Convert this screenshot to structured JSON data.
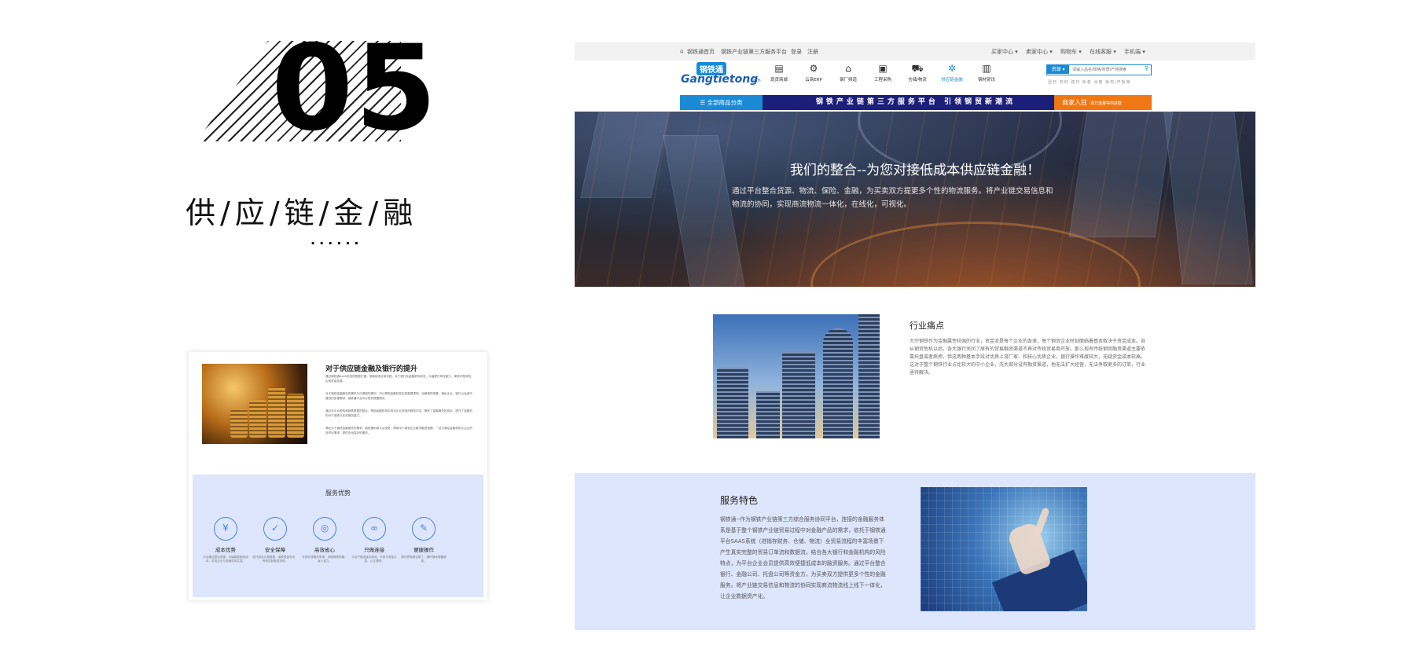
{
  "section": {
    "number": "05",
    "title": "供/应/链/金/融",
    "dots": "······"
  },
  "card": {
    "title": "对于供应链金融及银行的提升",
    "paragraphs": [
      "通过钢铁通SaaS系统的数据打通，准确反映交易流程，对于银行及金融机构而言，大幅提升风控能力，降低坏账风险，实现双赢发展。",
      "对于钢铁金融服务的需求与日俱增的情况，可以帮助金融机构实现数据透明，化解借贷难题，满足企业、银行以及城市建设的多重需求，钢铁通平台可以提供便捷服务。",
      "通过对平台采购和销售数据的整合，帮助金融机构实现对企业资信的精准评估，降低了金融服务的成本，提升了金融机构对于钢铁行业的服务能力。",
      "满足对于钢铁金融服务的需求，钢铁通利用平台优势，帮助中小钢铁企业解决融资难题，一站式满足金融机构与企业的多样化需求，提供安全高效的服务。"
    ],
    "services_title": "服务优势",
    "services": [
      {
        "icon": "cost-icon",
        "glyph": "¥",
        "name": "成本优势",
        "desc": "平台通过整合资源，大幅降低融资成本，实现企业与金融机构共赢。"
      },
      {
        "icon": "shield-icon",
        "glyph": "✓",
        "name": "安全保障",
        "desc": "依托真实交易数据，保障资金安全，有效控制各类风险。"
      },
      {
        "icon": "target-icon",
        "glyph": "◎",
        "name": "高效省心",
        "desc": "在线完成融资申请，流程简便快捷，省心省力。"
      },
      {
        "icon": "link-icon",
        "glyph": "∞",
        "name": "只做连接",
        "desc": "平台只做连接与服务，不参与资金交易，公正透明。"
      },
      {
        "icon": "doc-icon",
        "glyph": "✎",
        "name": "便捷操作",
        "desc": "操作界面简洁明了，随时随地便捷使用。"
      }
    ]
  },
  "site": {
    "topbar_left": [
      "钢铁通首页",
      "钢铁产业链第三方服务平台",
      "登录",
      "注册"
    ],
    "topbar_right": [
      "买家中心 ▾",
      "卖家中心 ▾",
      "购物车 ▾",
      "在线客服 ▾",
      "手机端 ▾"
    ],
    "logo_cn": "钢铁通",
    "logo_en": "Gangtietong",
    "logo_com": ".com",
    "nav": [
      {
        "icon": "store-icon",
        "glyph": "▤",
        "label": "现货商城",
        "active": false
      },
      {
        "icon": "gear-icon",
        "glyph": "⚙",
        "label": "云商ERP",
        "active": false
      },
      {
        "icon": "factory-icon",
        "glyph": "⌂",
        "label": "钢厂频道",
        "active": false
      },
      {
        "icon": "clipboard-icon",
        "glyph": "▣",
        "label": "工程采购",
        "active": false
      },
      {
        "icon": "truck-icon",
        "glyph": "⛟",
        "label": "仓储/物流",
        "active": false
      },
      {
        "icon": "network-icon",
        "glyph": "✲",
        "label": "供应链金融",
        "active": true
      },
      {
        "icon": "news-icon",
        "glyph": "▥",
        "label": "钢材资讯",
        "active": false
      }
    ],
    "search": {
      "type": "资源 ▾",
      "placeholder": "请输入品名/规格/材质/产地搜索"
    },
    "hot_words": "型材  管材  建材  板卷  涂镀  板材/开板等",
    "cat_all": "☰ 全部商品分类",
    "slogan": "钢铁产业链第三方服务平台   引领钢贸新潮流",
    "merchant": "商家入驻",
    "merchant_sub": "百万流量等你获取",
    "banner_title": "我们的整合--为您对接低成本供应链金融！",
    "banner_text": "通过平台整合货源、物流、保险、金融，为买卖双方提更多个性的物流服务。将产业链交易信息和物流的协同，实现商流物流一体化，在线化，可视化。"
  },
  "pain": {
    "title": "行业痛点",
    "text": "大宗钢铁作为金融属性较强的行业，资金流是每个企业的血液，每个钢贸企业时刻面临着基本取决于资金成本。自从钢贸危机以后，各大银行关闭了原有的贸易融资渠道不再对传统贸易商开放。那么现有传统钢贸融资渠道主要依靠托盘或者质押，但这两种基本手段对优质上游厂家、和核心优质企业，银行操作难度较大，无疑资金成本较高。这对于整个钢铁行业占比较大的中小企业，洗大部分没有融资渠道，他无法扩大经营，无法争取更多的订单，行业亟待解决。"
  },
  "features": {
    "title": "服务特色",
    "text": "钢铁通--作为钢铁产业链第三方综合服务协同平台，连接的金融服务体系是基于整个钢铁产业链贸易过程中对金融产品的需求，依托于钢铁通平台SAAS系统（进销存财务、仓储、物流）全贸易流程的丰富场景下产生真实完整的贸易订单流和数据流，结合各大银行和金融机构的风险特点，为平台企业会员提供高效便捷低成本的融资服务。通过平台整合银行、金融公司、托盘公司等资金方，为买卖双方提供更多个性的金融服务。将产业链交易信息和物流的协同实现商流物流线上线下一体化，让企业数据资产化。"
  }
}
